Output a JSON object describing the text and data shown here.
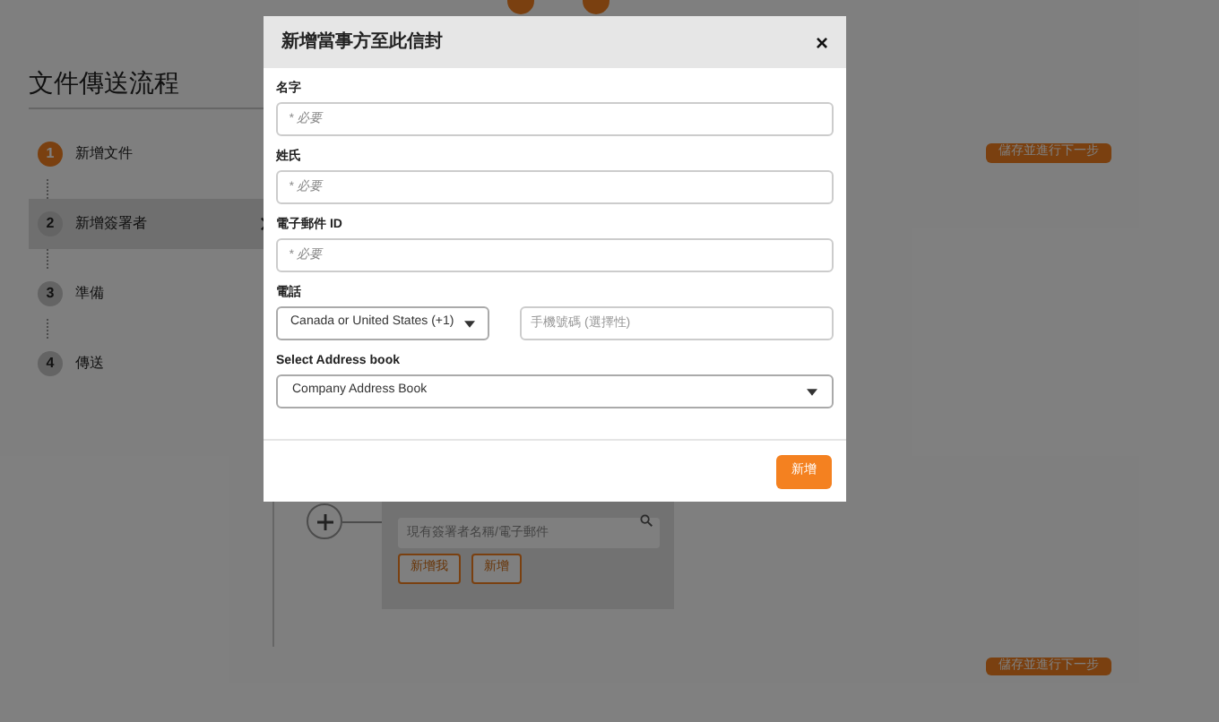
{
  "page": {
    "title": "文件傳送流程",
    "steps": [
      {
        "number": "1",
        "label": "新增文件",
        "completed": true,
        "selected": false
      },
      {
        "number": "2",
        "label": "新增簽署者",
        "completed": false,
        "selected": true
      },
      {
        "number": "3",
        "label": "準備",
        "completed": false,
        "selected": false
      },
      {
        "number": "4",
        "label": "傳送",
        "completed": false,
        "selected": false
      }
    ],
    "save_buttons": [
      "儲存並進行下一步",
      "儲存並進行下一步"
    ],
    "signer_search": {
      "placeholder": "現有簽署者名稱/電子郵件"
    },
    "signer_buttons": [
      "新增我",
      "新增"
    ]
  },
  "dialog": {
    "title": "新增當事方至此信封",
    "close": "×",
    "fields": [
      {
        "kind": "text",
        "label": "名字",
        "placeholder": "* 必要"
      },
      {
        "kind": "text",
        "label": "姓氏",
        "placeholder": "* 必要"
      },
      {
        "kind": "text",
        "label": "電子郵件 ID",
        "placeholder": "* 必要"
      },
      {
        "kind": "phone",
        "label": "電話",
        "value": "Canada or United States (+1)",
        "placeholder": "手機號碼 (選擇性)"
      },
      {
        "kind": "select",
        "label": "Select Address book",
        "value": "Company Address Book"
      }
    ],
    "submit": "新增"
  }
}
